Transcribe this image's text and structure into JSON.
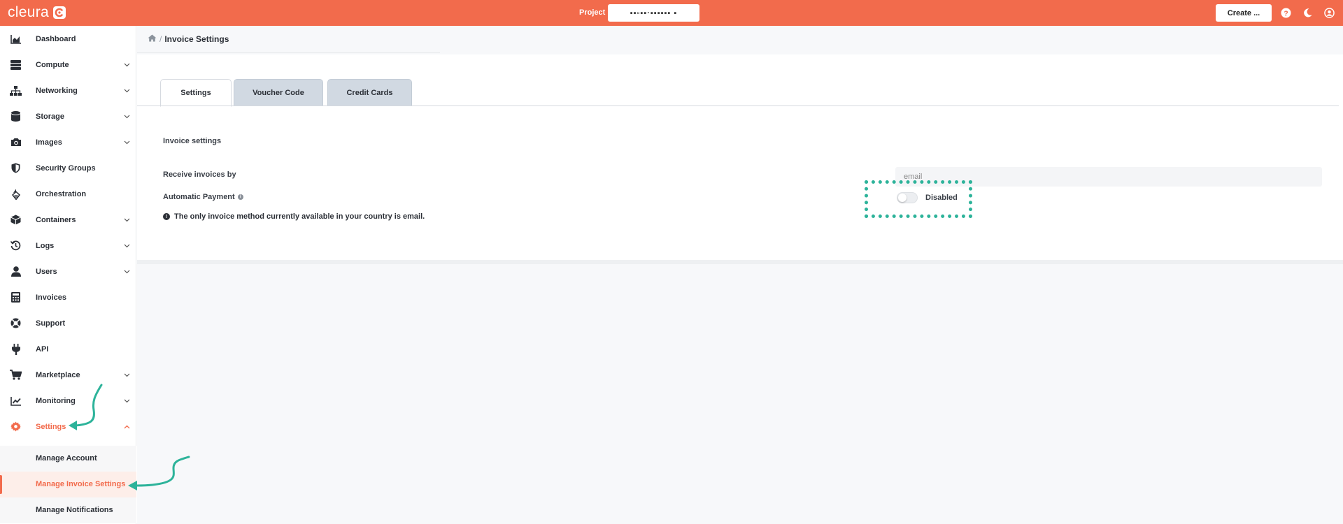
{
  "colors": {
    "brand": "#f26b4c",
    "annotation": "#2db39a"
  },
  "topbar": {
    "brand_name": "cleura",
    "project_label": "Project",
    "project_value": "▪▪▫▪▪·▪▪▪▪▪▪ ▪",
    "create_label": "Create ...",
    "icons": [
      "help-icon",
      "moon-icon",
      "user-icon"
    ]
  },
  "sidebar": {
    "items": [
      {
        "label": "Dashboard",
        "icon": "chart-area-icon"
      },
      {
        "label": "Compute",
        "icon": "server-icon"
      },
      {
        "label": "Networking",
        "icon": "sitemap-icon"
      },
      {
        "label": "Storage",
        "icon": "database-icon"
      },
      {
        "label": "Images",
        "icon": "camera-icon"
      },
      {
        "label": "Security Groups",
        "icon": "shield-icon"
      },
      {
        "label": "Orchestration",
        "icon": "orchestration-icon"
      },
      {
        "label": "Containers",
        "icon": "cube-icon"
      },
      {
        "label": "Logs",
        "icon": "history-icon"
      },
      {
        "label": "Users",
        "icon": "user-icon"
      },
      {
        "label": "Invoices",
        "icon": "calculator-icon"
      },
      {
        "label": "Support",
        "icon": "lifering-icon"
      },
      {
        "label": "API",
        "icon": "plug-icon"
      },
      {
        "label": "Marketplace",
        "icon": "cart-icon"
      },
      {
        "label": "Monitoring",
        "icon": "chart-line-icon"
      },
      {
        "label": "Settings",
        "icon": "gear-icon"
      }
    ],
    "settings_subitems": [
      {
        "label": "Manage Account"
      },
      {
        "label": "Manage Invoice Settings"
      },
      {
        "label": "Manage Notifications"
      }
    ]
  },
  "breadcrumb": {
    "current": "Invoice Settings",
    "separator": "/"
  },
  "tabs": [
    {
      "label": "Settings",
      "active": true
    },
    {
      "label": "Voucher Code",
      "active": false
    },
    {
      "label": "Credit Cards",
      "active": false
    }
  ],
  "invoice": {
    "section_title": "Invoice settings",
    "receive_label": "Receive invoices by",
    "receive_value": "email",
    "auto_payment_label": "Automatic Payment",
    "auto_payment_state": "Disabled",
    "auto_payment_enabled": false,
    "notice": "The only invoice method currently available in your country is email."
  }
}
